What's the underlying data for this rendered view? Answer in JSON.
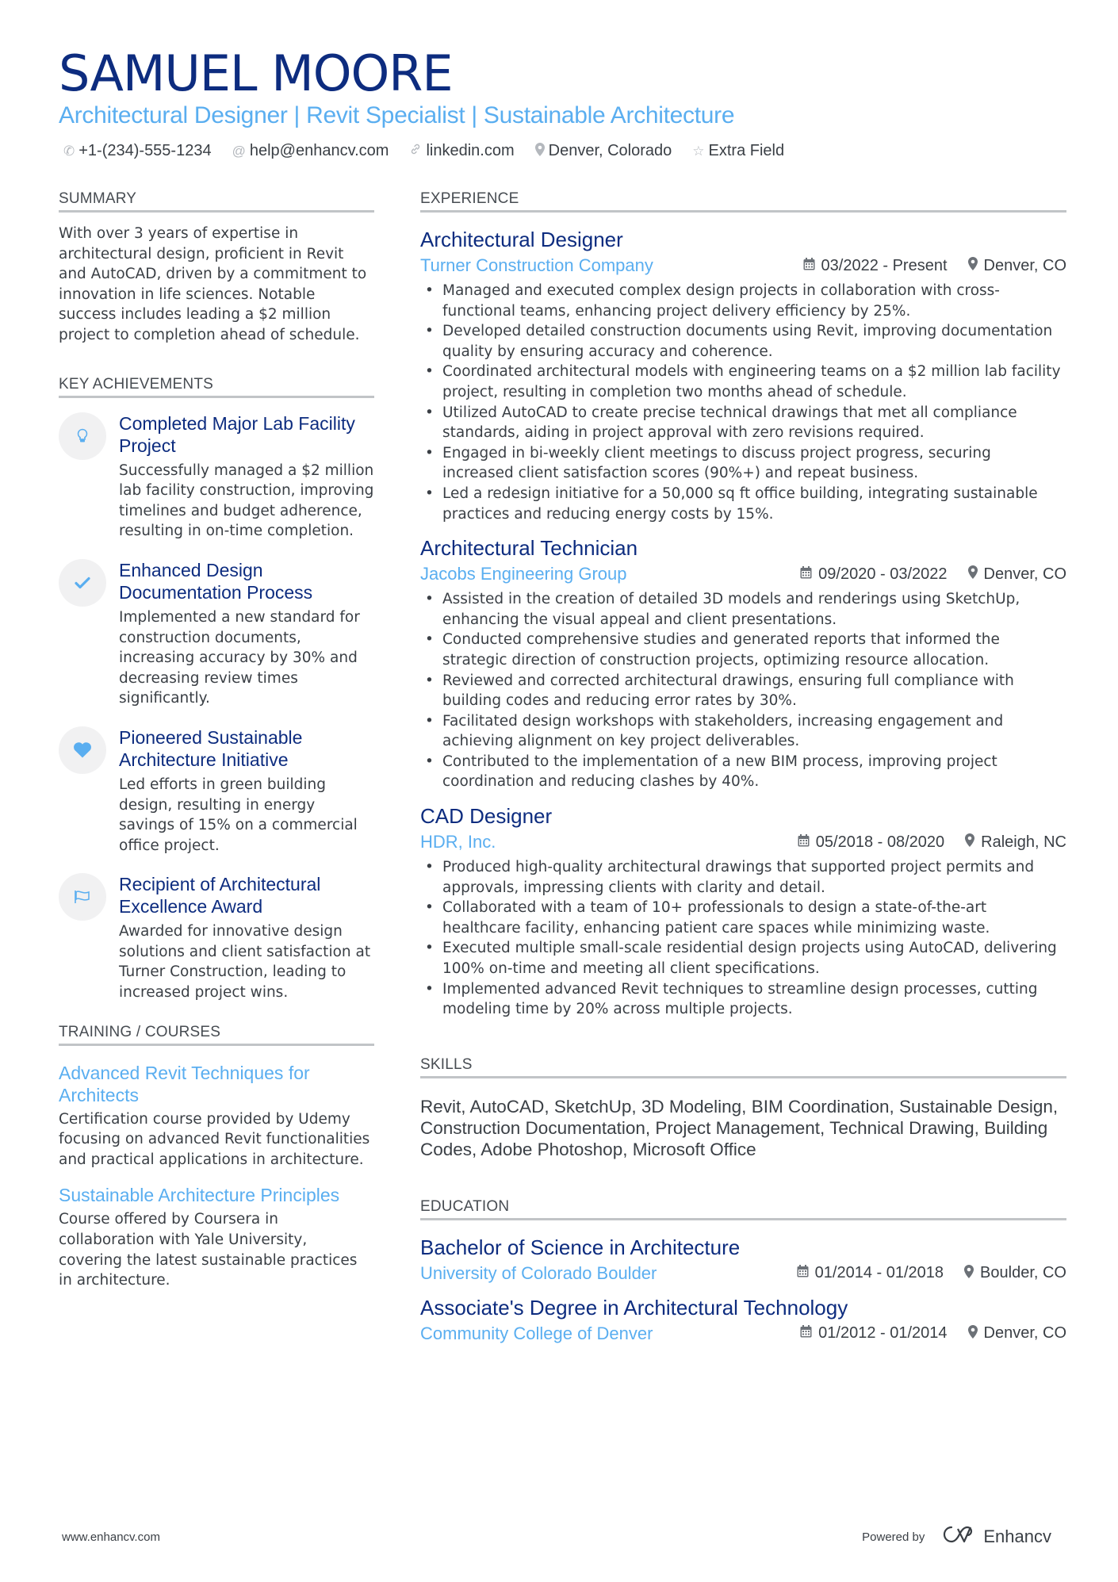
{
  "header": {
    "name": "SAMUEL MOORE",
    "headline": "Architectural Designer | Revit Specialist | Sustainable Architecture",
    "contacts": [
      {
        "icon": "phone-icon",
        "glyph": "✆",
        "text": "+1-(234)-555-1234"
      },
      {
        "icon": "at-icon",
        "glyph": "@",
        "text": "help@enhancv.com"
      },
      {
        "icon": "link-icon",
        "glyph": "⚭",
        "text": "linkedin.com"
      },
      {
        "icon": "location-pin-icon",
        "glyph": "⬤",
        "text": "Denver, Colorado"
      },
      {
        "icon": "star-icon",
        "glyph": "☆",
        "text": "Extra Field"
      }
    ]
  },
  "colors": {
    "navy": "#0d2c7f",
    "accent": "#5aaef0",
    "text": "#3a3f45",
    "rule": "#c1c4c7"
  },
  "summary": {
    "title": "SUMMARY",
    "text": "With over 3 years of expertise in architectural design, proficient in Revit and AutoCAD, driven by a commitment to innovation in life sciences. Notable success includes leading a $2 million project to completion ahead of schedule."
  },
  "achievements": {
    "title": "KEY ACHIEVEMENTS",
    "items": [
      {
        "icon": "lightbulb-icon",
        "title": "Completed Major Lab Facility Project",
        "text": "Successfully managed a $2 million lab facility construction, improving timelines and budget adherence, resulting in on-time completion."
      },
      {
        "icon": "checkmark-icon",
        "title": "Enhanced Design Documentation Process",
        "text": "Implemented a new standard for construction documents, increasing accuracy by 30% and decreasing review times significantly."
      },
      {
        "icon": "heart-icon",
        "title": "Pioneered Sustainable Architecture Initiative",
        "text": "Led efforts in green building design, resulting in energy savings of 15% on a commercial office project."
      },
      {
        "icon": "flag-icon",
        "title": "Recipient of Architectural Excellence Award",
        "text": "Awarded for innovative design solutions and client satisfaction at Turner Construction, leading to increased project wins."
      }
    ]
  },
  "training": {
    "title": "TRAINING / COURSES",
    "items": [
      {
        "title": "Advanced Revit Techniques for Architects",
        "text": "Certification course provided by Udemy focusing on advanced Revit functionalities and practical applications in architecture."
      },
      {
        "title": "Sustainable Architecture Principles",
        "text": "Course offered by Coursera in collaboration with Yale University, covering the latest sustainable practices in architecture."
      }
    ]
  },
  "experience": {
    "title": "EXPERIENCE",
    "jobs": [
      {
        "title": "Architectural Designer",
        "company": "Turner Construction Company",
        "dates": "03/2022 - Present",
        "location": "Denver, CO",
        "bullets": [
          "Managed and executed complex design projects in collaboration with cross-functional teams, enhancing project delivery efficiency by 25%.",
          "Developed detailed construction documents using Revit, improving documentation quality by ensuring accuracy and coherence.",
          "Coordinated architectural models with engineering teams on a $2 million lab facility project, resulting in completion two months ahead of schedule.",
          "Utilized AutoCAD to create precise technical drawings that met all compliance standards, aiding in project approval with zero revisions required.",
          "Engaged in bi-weekly client meetings to discuss project progress, securing increased client satisfaction scores (90%+) and repeat business.",
          "Led a redesign initiative for a 50,000 sq ft office building, integrating sustainable practices and reducing energy costs by 15%."
        ]
      },
      {
        "title": "Architectural Technician",
        "company": "Jacobs Engineering Group",
        "dates": "09/2020 - 03/2022",
        "location": "Denver, CO",
        "bullets": [
          "Assisted in the creation of detailed 3D models and renderings using SketchUp, enhancing the visual appeal and client presentations.",
          "Conducted comprehensive studies and generated reports that informed the strategic direction of construction projects, optimizing resource allocation.",
          "Reviewed and corrected architectural drawings, ensuring full compliance with building codes and reducing error rates by 30%.",
          "Facilitated design workshops with stakeholders, increasing engagement and achieving alignment on key project deliverables.",
          "Contributed to the implementation of a new BIM process, improving project coordination and reducing clashes by 40%."
        ]
      },
      {
        "title": "CAD Designer",
        "company": "HDR, Inc.",
        "dates": "05/2018 - 08/2020",
        "location": "Raleigh, NC",
        "bullets": [
          "Produced high-quality architectural drawings that supported project permits and approvals, impressing clients with clarity and detail.",
          "Collaborated with a team of 10+ professionals to design a state-of-the-art healthcare facility, enhancing patient care spaces while minimizing waste.",
          "Executed multiple small-scale residential design projects using AutoCAD, delivering 100% on-time and meeting all client specifications.",
          "Implemented advanced Revit techniques to streamline design processes, cutting modeling time by 20% across multiple projects."
        ]
      }
    ]
  },
  "skills": {
    "title": "SKILLS",
    "text": "Revit, AutoCAD, SketchUp, 3D Modeling, BIM Coordination, Sustainable Design, Construction Documentation, Project Management, Technical Drawing, Building Codes, Adobe Photoshop, Microsoft Office"
  },
  "education": {
    "title": "EDUCATION",
    "items": [
      {
        "degree": "Bachelor of Science in Architecture",
        "school": "University of Colorado Boulder",
        "dates": "01/2014 - 01/2018",
        "location": "Boulder, CO"
      },
      {
        "degree": "Associate's Degree in Architectural Technology",
        "school": "Community College of Denver",
        "dates": "01/2012 - 01/2014",
        "location": "Denver, CO"
      }
    ]
  },
  "footer": {
    "website": "www.enhancv.com",
    "powered_by": "Powered by",
    "brand": "Enhancv"
  }
}
